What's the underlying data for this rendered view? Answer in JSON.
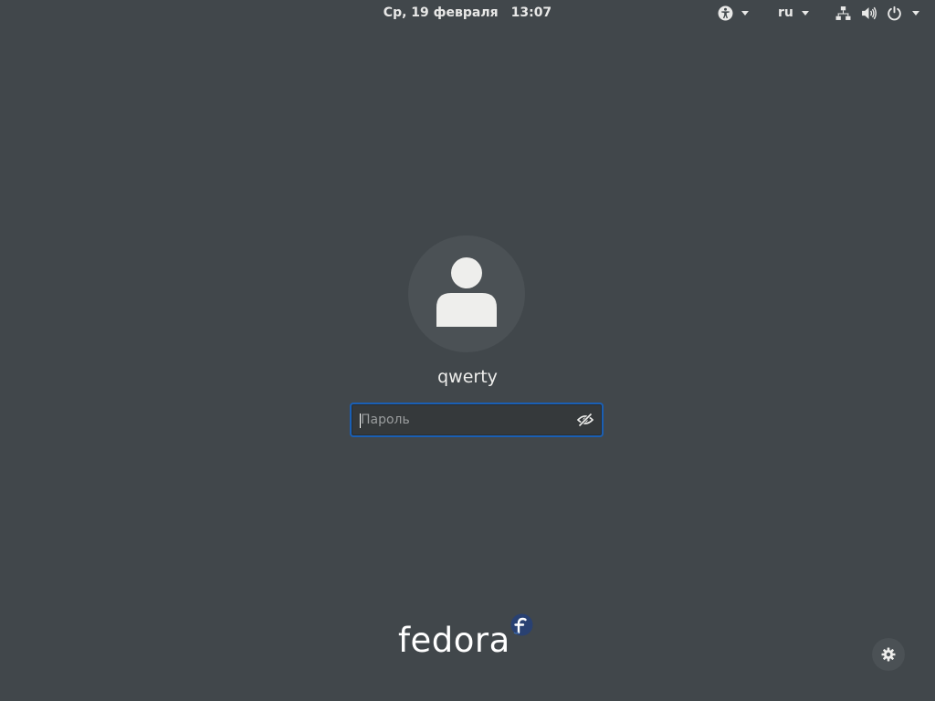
{
  "topbar": {
    "date": "Ср, 19 февраля",
    "time": "13:07",
    "accessibility_icon": "accessibility-icon",
    "language": "ru",
    "network_icon": "network-wired-icon",
    "volume_icon": "volume-icon",
    "power_icon": "power-icon"
  },
  "login": {
    "avatar_icon": "user-avatar-icon",
    "username": "qwerty",
    "password_placeholder": "Пароль",
    "password_value": "",
    "reveal_icon": "eye-hidden-icon"
  },
  "branding": {
    "logo_text": "fedora",
    "logo_color": "#ffffff",
    "badge_color": "#294172"
  },
  "settings_icon": "gear-icon",
  "colors": {
    "background": "#41474b",
    "accent": "#1a5fb4"
  }
}
